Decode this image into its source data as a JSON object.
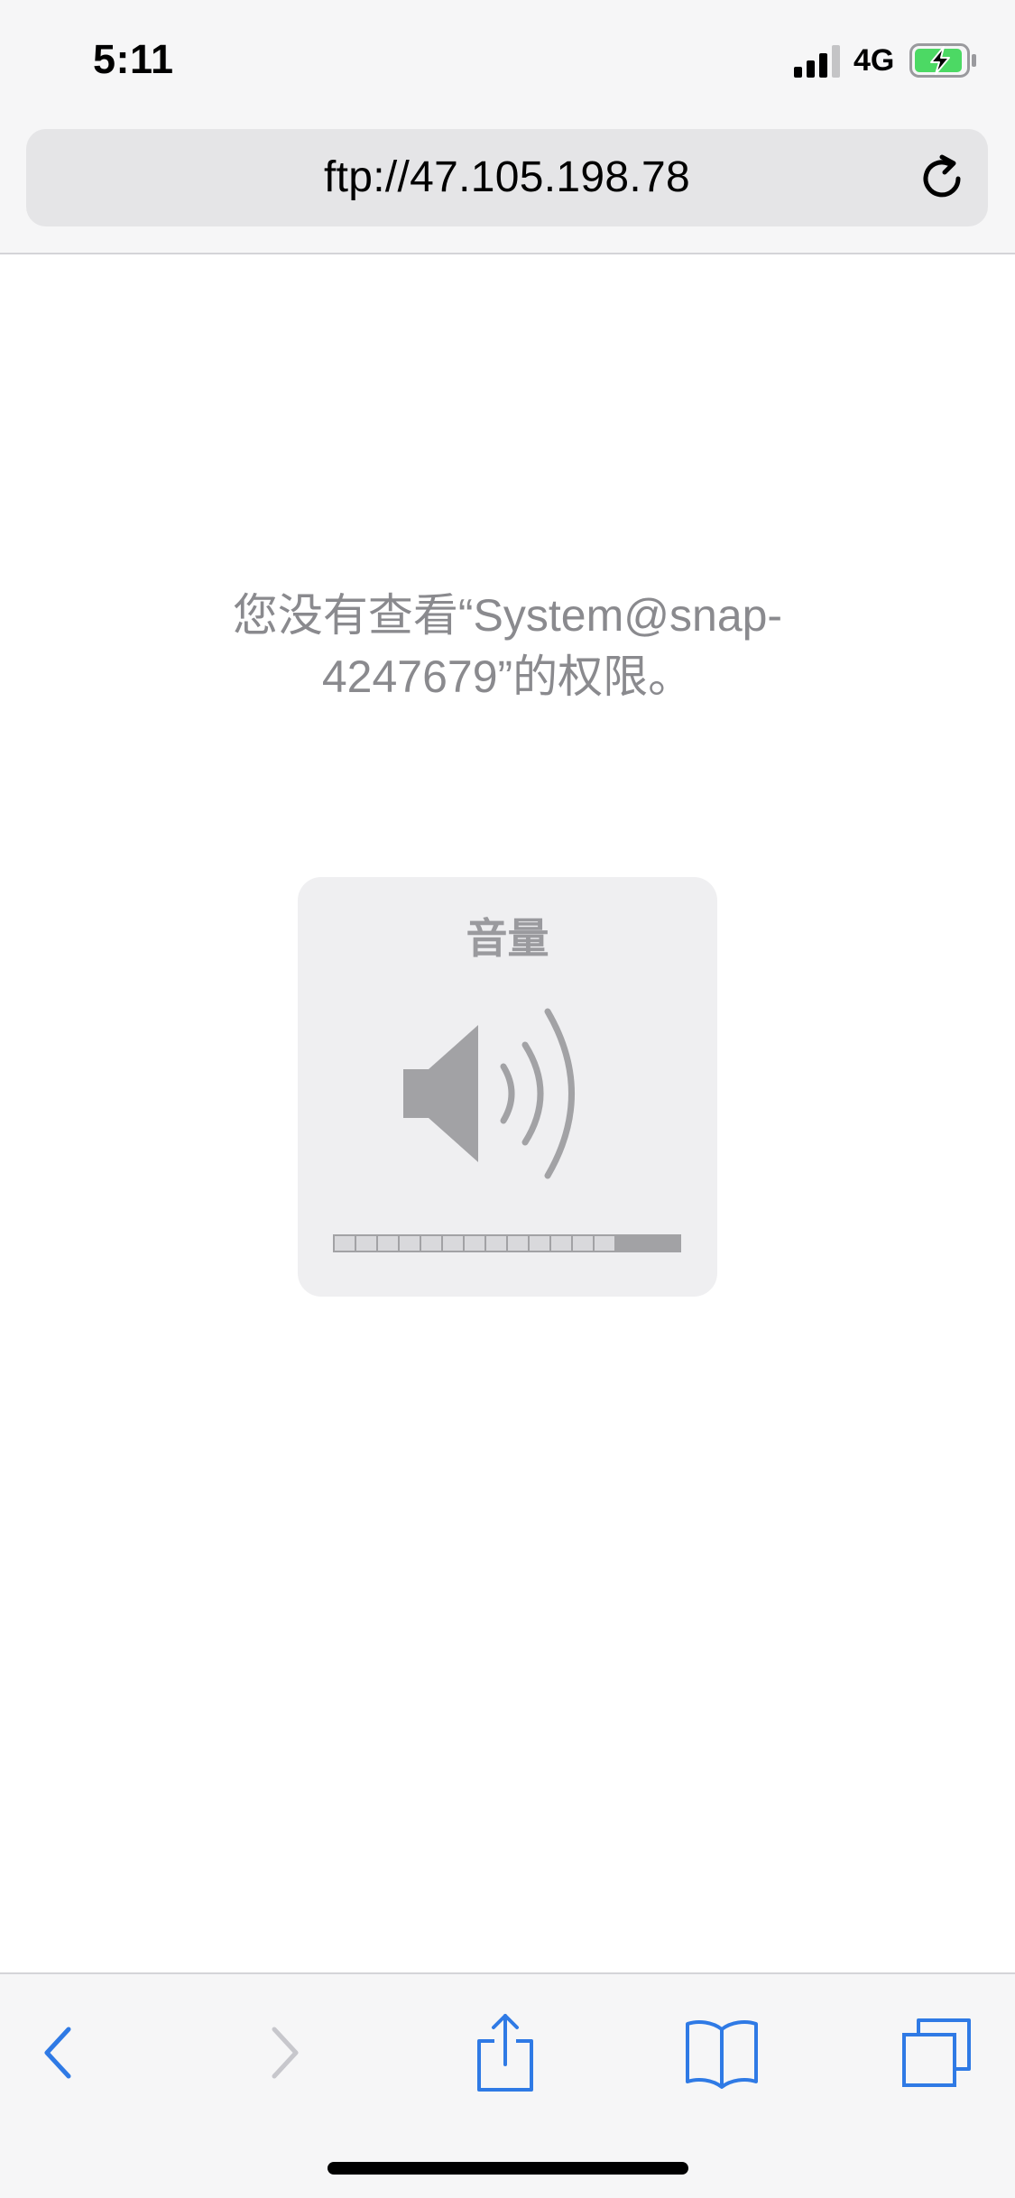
{
  "status_bar": {
    "time": "5:11",
    "network": "4G",
    "signal_icon": "cellular-signal-icon",
    "battery_icon": "battery-charging-icon",
    "battery_color": "#4cd964"
  },
  "address_bar": {
    "url": "ftp://47.105.198.78",
    "reload_icon": "reload-icon"
  },
  "content": {
    "error_line1": "您没有查看“System@snap-",
    "error_line2": "4247679”的权限。"
  },
  "volume_hud": {
    "title": "音量",
    "icon": "speaker-volume-icon",
    "level": 0.8,
    "segments_total": 16
  },
  "toolbar": {
    "back_icon": "chevron-left-icon",
    "forward_icon": "chevron-right-icon",
    "share_icon": "share-icon",
    "bookmarks_icon": "book-icon",
    "tabs_icon": "tabs-icon",
    "accent_color": "#2f7ae5",
    "disabled_color": "#c7c7cc"
  }
}
